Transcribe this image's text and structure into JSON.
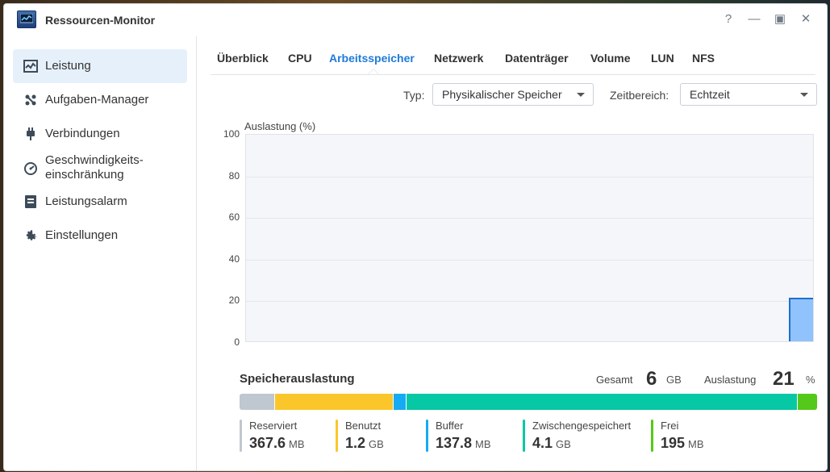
{
  "window": {
    "title": "Ressourcen-Monitor",
    "controls": {
      "help": "?",
      "minimize": "—",
      "maximize": "▣",
      "close": "✕"
    }
  },
  "sidebar": {
    "items": [
      {
        "label": "Leistung",
        "icon": "performance-chart-icon",
        "active": true
      },
      {
        "label": "Aufgaben-Manager",
        "icon": "task-manager-icon"
      },
      {
        "label": "Verbindungen",
        "icon": "plug-icon"
      },
      {
        "label": "Geschwindigkeits-",
        "label2": "einschränkung",
        "icon": "speed-gauge-icon"
      },
      {
        "label": "Leistungsalarm",
        "icon": "alarm-list-icon"
      },
      {
        "label": "Einstellungen",
        "icon": "gear-icon"
      }
    ]
  },
  "tabs": [
    {
      "label": "Überblick"
    },
    {
      "label": "CPU"
    },
    {
      "label": "Arbeitsspeicher",
      "active": true
    },
    {
      "label": "Netzwerk"
    },
    {
      "label": "Datenträger"
    },
    {
      "label": "Volume"
    },
    {
      "label": "LUN"
    },
    {
      "label": "NFS"
    }
  ],
  "filters": {
    "type_label": "Typ:",
    "type_value": "Physikalischer Speicher",
    "range_label": "Zeitbereich:",
    "range_value": "Echtzeit"
  },
  "chart_data": {
    "type": "area",
    "ylabel": "Auslastung (%)",
    "ylim": [
      0,
      100
    ],
    "yticks": [
      "100",
      "80",
      "60",
      "40",
      "20",
      "0"
    ],
    "series": [
      {
        "values": [
          21
        ],
        "color": "#90c2fb"
      }
    ]
  },
  "memory": {
    "title": "Speicherauslastung",
    "total_label": "Gesamt",
    "total_value": "6",
    "total_unit": "GB",
    "usage_label": "Auslastung",
    "usage_value": "21",
    "usage_unit": "%",
    "segments": [
      {
        "name": "Reserviert",
        "value": "367.6",
        "unit": "MB",
        "color": "#bfc7d0",
        "fraction": 0.06
      },
      {
        "name": "Benutzt",
        "value": "1.2",
        "unit": "GB",
        "color": "#fbc629",
        "fraction": 0.205
      },
      {
        "name": "Buffer",
        "value": "137.8",
        "unit": "MB",
        "color": "#16aaf3",
        "fraction": 0.023
      },
      {
        "name": "Zwischengespeichert",
        "value": "4.1",
        "unit": "GB",
        "color": "#06c8a4",
        "fraction": 0.677
      },
      {
        "name": "Frei",
        "value": "195",
        "unit": "MB",
        "color": "#55c91a",
        "fraction": 0.035
      }
    ]
  }
}
